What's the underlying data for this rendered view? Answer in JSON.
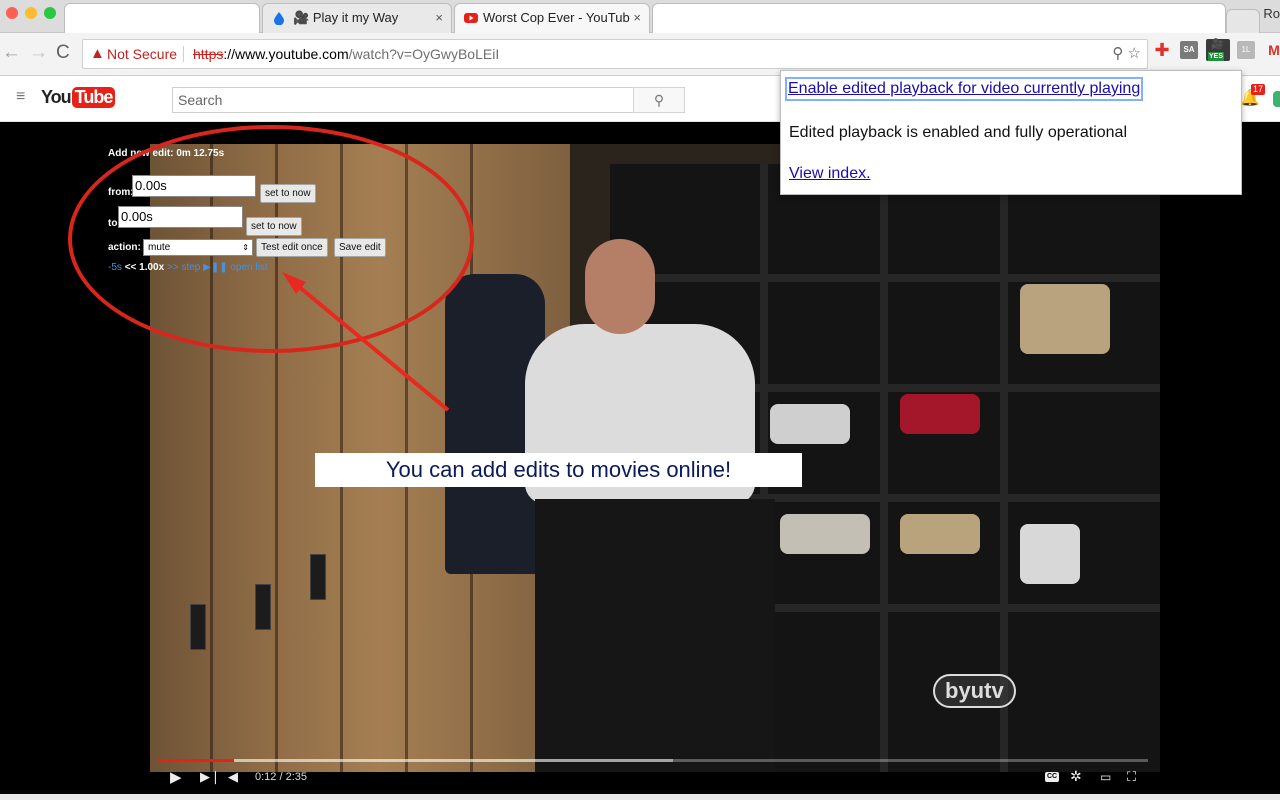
{
  "browser": {
    "tabs": [
      {
        "label": ""
      },
      {
        "label": "Play it my Way",
        "close": "×"
      },
      {
        "label": "Worst Cop Ever - YouTub",
        "close": "×"
      },
      {
        "label": ""
      }
    ],
    "profile_label": "Ro",
    "nav": {
      "back": "←",
      "forward": "→",
      "reload": "C"
    },
    "address": {
      "security_label": "Not Secure",
      "scheme": "https",
      "host": "://www.youtube.com",
      "path": "/watch?v=OyGwyBoLEiI"
    },
    "extensions": [
      {
        "name": "plus-extension-icon",
        "text": "✚"
      },
      {
        "name": "sa-extension-icon",
        "text": "SA"
      },
      {
        "name": "play-it-my-way-extension-icon",
        "text": "YES"
      },
      {
        "name": "grey-extension-icon",
        "text": "1L"
      },
      {
        "name": "gmail-extension-icon",
        "text": "M"
      }
    ]
  },
  "youtube": {
    "menu_icon": "≡",
    "logo_you": "You",
    "logo_tube": "Tube",
    "search_placeholder": "Search",
    "search_icon": "⚲",
    "notification_count": "17",
    "bell_icon": "🔔"
  },
  "player": {
    "current_time": "0:12",
    "duration": "2:35",
    "time_display": "0:12 / 2:35",
    "progress_fraction": 0.077,
    "buffered_fraction": 0.52,
    "watermark": "byutv",
    "cc_label": "CC"
  },
  "edit_panel": {
    "title": "Add new edit: 0m 12.75s",
    "from_label": "from:",
    "from_value": "0.00s",
    "to_label": "to:",
    "to_value": "0.00s",
    "set_to_now": "set to now",
    "action_label": "action:",
    "action_value": "mute",
    "test_button": "Test edit once",
    "save_button": "Save edit",
    "links": {
      "back5": "-5s",
      "slower": "<<",
      "speed": "1.00x",
      "faster": ">>",
      "step": "step",
      "play_pause": "▶❚❚",
      "open_list": "open list"
    }
  },
  "caption": "You can add edits to movies online!",
  "popup": {
    "enable_link": "Enable edited playback for video currently playing",
    "status": "Edited playback is enabled and fully operational",
    "index_link": "View index."
  }
}
